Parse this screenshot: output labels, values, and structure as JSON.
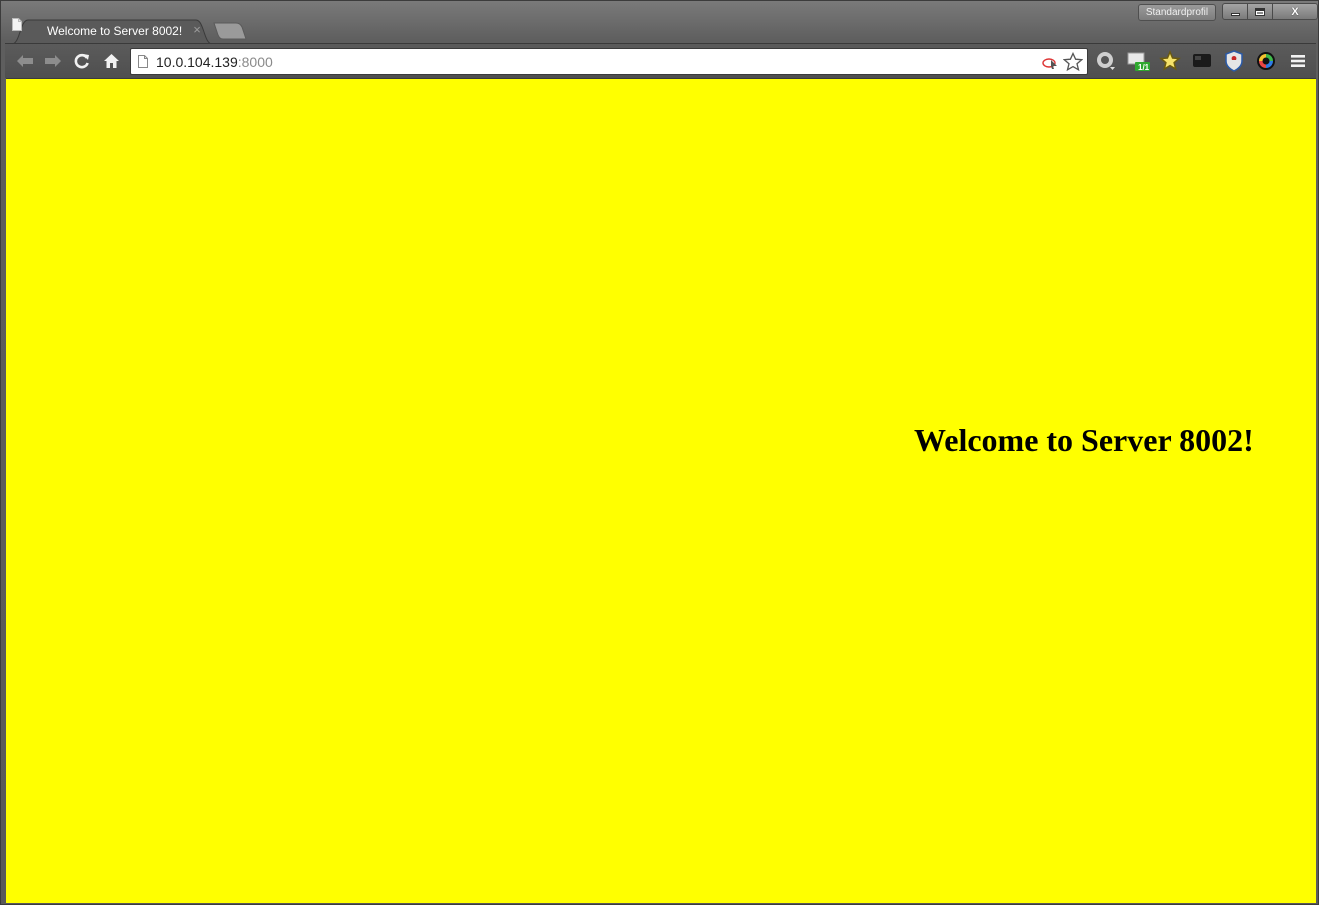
{
  "browser": {
    "profile_label": "Standardprofil",
    "tab": {
      "title": "Welcome to Server 8002!",
      "close_glyph": "×"
    },
    "address": {
      "host": "10.0.104.139",
      "port": ":8000"
    },
    "nav_icons": [
      "back-arrow-icon",
      "forward-arrow-icon",
      "reload-icon",
      "home-icon"
    ],
    "extension_icons": [
      "chrome-ring-extension-icon",
      "screen-badge-extension-icon",
      "star-extension-icon",
      "dark-square-extension-icon",
      "shield-extension-icon",
      "color-wheel-extension-icon",
      "menu-icon"
    ],
    "extension_badge": "1/1",
    "window_controls": {
      "minimize": "minimize",
      "maximize": "maximize",
      "close": "X"
    }
  },
  "page": {
    "heading": "Welcome to Server 8002!",
    "background_color": "#ffff00"
  }
}
